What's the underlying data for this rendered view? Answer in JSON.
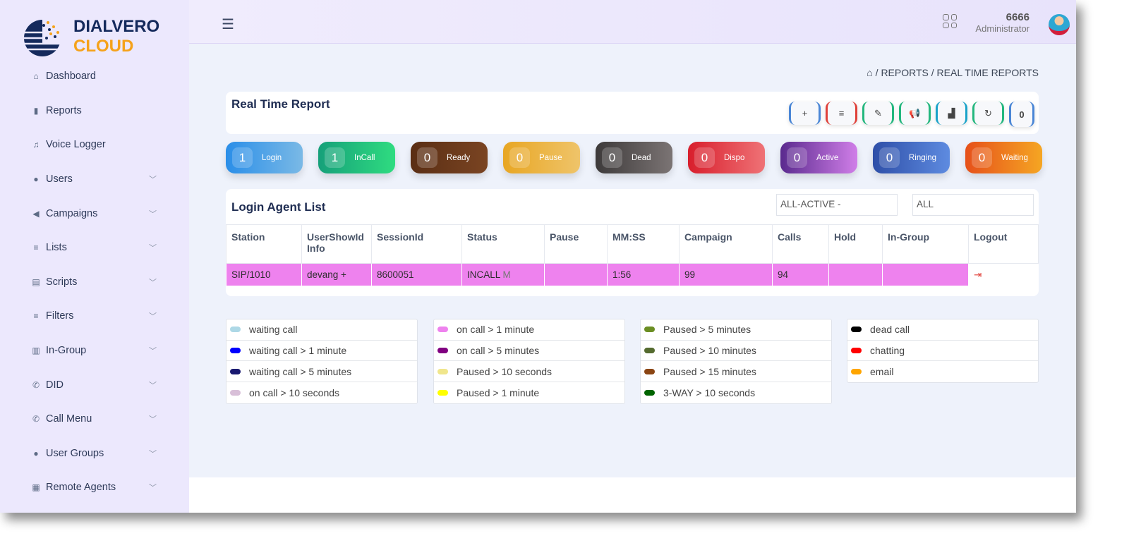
{
  "brand": {
    "line1": "DIALVERO",
    "line2": "CLOUD"
  },
  "sidebar": {
    "items": [
      {
        "label": "Dashboard",
        "icon": "home-icon",
        "glyph": "⌂",
        "chev": false
      },
      {
        "label": "Reports",
        "icon": "bar-chart-icon",
        "glyph": "▮",
        "chev": false
      },
      {
        "label": "Voice Logger",
        "icon": "music-file-icon",
        "glyph": "♫",
        "chev": false
      },
      {
        "label": "Users",
        "icon": "user-icon",
        "glyph": "●",
        "chev": true
      },
      {
        "label": "Campaigns",
        "icon": "megaphone-icon",
        "glyph": "◀",
        "chev": true
      },
      {
        "label": "Lists",
        "icon": "list-icon",
        "glyph": "≡",
        "chev": true
      },
      {
        "label": "Scripts",
        "icon": "document-icon",
        "glyph": "▤",
        "chev": true
      },
      {
        "label": "Filters",
        "icon": "filter-icon",
        "glyph": "≡",
        "chev": true
      },
      {
        "label": "In-Group",
        "icon": "map-icon",
        "glyph": "▥",
        "chev": true
      },
      {
        "label": "DID",
        "icon": "phone-icon",
        "glyph": "✆",
        "chev": true
      },
      {
        "label": "Call Menu",
        "icon": "phone-forward-icon",
        "glyph": "✆",
        "chev": true
      },
      {
        "label": "User Groups",
        "icon": "users-icon",
        "glyph": "●",
        "chev": true
      },
      {
        "label": "Remote Agents",
        "icon": "table-icon",
        "glyph": "▦",
        "chev": true
      }
    ]
  },
  "header": {
    "user_id": "6666",
    "role": "Administrator"
  },
  "breadcrumb": {
    "items": [
      "REPORTS",
      "REAL TIME REPORTS"
    ]
  },
  "report": {
    "title": "Real Time Report",
    "toolbar": [
      {
        "icon": "plus-icon",
        "glyph": "+",
        "color": "#4a86d6"
      },
      {
        "icon": "list-icon",
        "glyph": "≡",
        "color": "#e0413a"
      },
      {
        "icon": "edit-icon",
        "glyph": "✎",
        "color": "#23b77e"
      },
      {
        "icon": "megaphone-icon",
        "glyph": "📢",
        "color": "#23b77e"
      },
      {
        "icon": "bar-chart-icon",
        "glyph": "▟",
        "color": "#1aa3c9"
      },
      {
        "icon": "refresh-icon",
        "glyph": "↻",
        "color": "#23b77e"
      },
      {
        "icon": "counter",
        "glyph": "0",
        "color": "#4a86d6"
      }
    ]
  },
  "stats": [
    {
      "value": "1",
      "label": "Login",
      "bg": "linear-gradient(90deg,#2a8ee8,#7ab9e6)"
    },
    {
      "value": "1",
      "label": "InCall",
      "bg": "linear-gradient(90deg,#16a07a,#2fdc80)"
    },
    {
      "value": "0",
      "label": "Ready",
      "bg": "linear-gradient(90deg,#5a2e14,#7a4422)"
    },
    {
      "value": "0",
      "label": "Pause",
      "bg": "linear-gradient(90deg,#e8a623,#efc46a)"
    },
    {
      "value": "0",
      "label": "Dead",
      "bg": "linear-gradient(90deg,#3d3a3a,#7b7474)"
    },
    {
      "value": "0",
      "label": "Dispo",
      "bg": "linear-gradient(90deg,#d81e2c,#ef7276)"
    },
    {
      "value": "0",
      "label": "Active",
      "bg": "linear-gradient(90deg,#5a2a8e,#d07ee8)"
    },
    {
      "value": "0",
      "label": "Ringing",
      "bg": "linear-gradient(90deg,#2e4fa8,#5e8be0)"
    },
    {
      "value": "0",
      "label": "Waiting",
      "bg": "linear-gradient(90deg,#e6501a,#f5a623)"
    }
  ],
  "agents": {
    "title": "Login Agent List",
    "filter1": "ALL-ACTIVE -",
    "filter2": "ALL",
    "columns": [
      "Station",
      "UserShowId Info",
      "SessionId",
      "Status",
      "Pause",
      "MM:SS",
      "Campaign",
      "Calls",
      "Hold",
      "In-Group",
      "Logout"
    ],
    "rows": [
      {
        "station": "SIP/1010",
        "user": "devang +",
        "session": "8600051",
        "status": "INCALL",
        "status_flag": "M",
        "pause": "",
        "mmss": "1:56",
        "campaign": "99",
        "calls": "94",
        "hold": "",
        "ingroup": ""
      }
    ]
  },
  "legend": [
    [
      {
        "label": "waiting call",
        "color": "#add8e6"
      },
      {
        "label": "waiting call > 1 minute",
        "color": "#0000ff"
      },
      {
        "label": "waiting call > 5 minutes",
        "color": "#191970"
      },
      {
        "label": "on call > 10 seconds",
        "color": "#d8bfd8"
      }
    ],
    [
      {
        "label": "on call > 1 minute",
        "color": "#ee82ee"
      },
      {
        "label": "on call > 5 minutes",
        "color": "#800080"
      },
      {
        "label": "Paused > 10 seconds",
        "color": "#f0e68c"
      },
      {
        "label": "Paused > 1 minute",
        "color": "#ffff00"
      }
    ],
    [
      {
        "label": "Paused > 5 minutes",
        "color": "#6b8e23"
      },
      {
        "label": "Paused > 10 minutes",
        "color": "#556b2f"
      },
      {
        "label": "Paused > 15 minutes",
        "color": "#8b4513"
      },
      {
        "label": "3-WAY > 10 seconds",
        "color": "#006400"
      }
    ],
    [
      {
        "label": "dead call",
        "color": "#000000"
      },
      {
        "label": "chatting",
        "color": "#ff0000"
      },
      {
        "label": "email",
        "color": "#ffa500"
      }
    ]
  ]
}
